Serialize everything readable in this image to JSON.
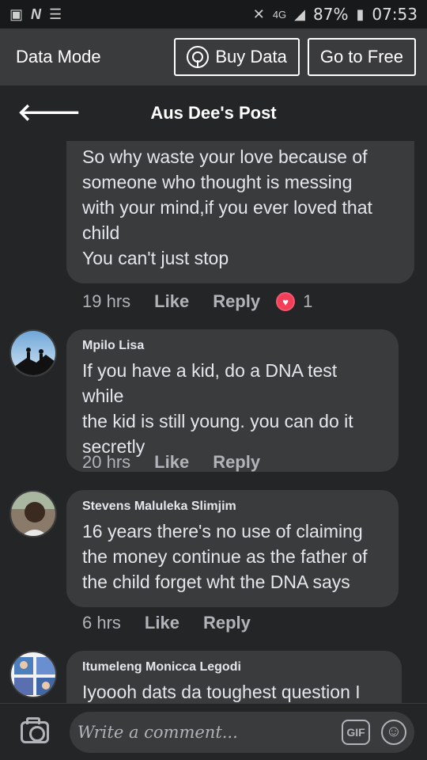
{
  "status_bar": {
    "network": "4G",
    "battery": "87%",
    "time": "07:53",
    "icons": [
      "picture-icon",
      "n-icon",
      "list-icon",
      "mute-icon",
      "signal-icon",
      "battery-icon"
    ]
  },
  "data_bar": {
    "title": "Data Mode",
    "buy_data_label": "Buy Data",
    "go_free_label": "Go to Free"
  },
  "header": {
    "title": "Aus Dee's Post",
    "back_icon": "back-arrow-icon"
  },
  "comments": [
    {
      "author": "",
      "text": "So why waste your love because of\nsomeone who thought is messing\nwith your mind,if you ever loved that\nchild\nYou can't just stop",
      "time": "19 hrs",
      "like_label": "Like",
      "reply_label": "Reply",
      "reaction_count": "1",
      "reaction_color": "#f33e58"
    },
    {
      "author": "Mpilo Lisa",
      "text": "If you have a kid, do a DNA test while\nthe kid is still young. you can do it\nsecretly",
      "time": "20 hrs",
      "like_label": "Like",
      "reply_label": "Reply"
    },
    {
      "author": "Stevens Maluleka Slimjim",
      "text": "16 years there's no use of claiming\nthe money continue as the father of\nthe child forget wht the DNA says",
      "time": "6 hrs",
      "like_label": "Like",
      "reply_label": "Reply"
    },
    {
      "author": "Itumeleng Monicca Legodi",
      "text": "Iyoooh dats da toughest question I",
      "time": "",
      "like_label": "",
      "reply_label": ""
    }
  ],
  "composer": {
    "placeholder": "Write a comment...",
    "gif_label": "GIF"
  },
  "colors": {
    "background": "#242526",
    "bubble": "#3a3b3c",
    "text": "#e4e6eb",
    "meta": "#b0b3b8",
    "reaction": "#f33e58"
  }
}
